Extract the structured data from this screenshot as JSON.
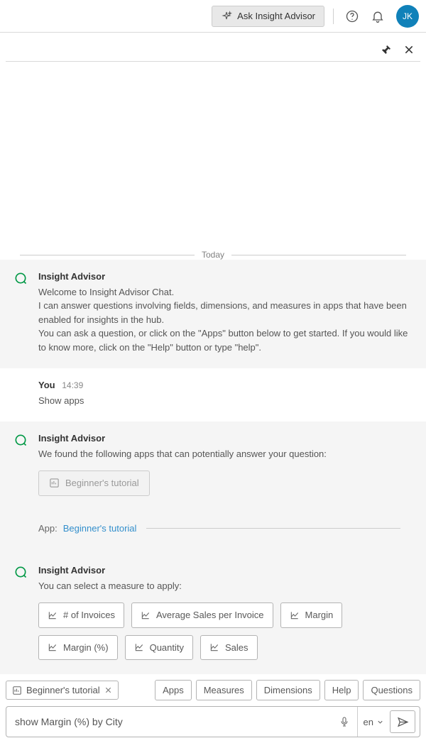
{
  "topbar": {
    "ask_label": "Ask Insight Advisor",
    "avatar_initials": "JK"
  },
  "chat": {
    "date_label": "Today",
    "messages": [
      {
        "sender": "Insight Advisor",
        "lines": [
          "Welcome to Insight Advisor Chat.",
          "I can answer questions involving fields, dimensions, and measures in apps that have been enabled for insights in the hub.",
          "You can ask a question, or click on the \"Apps\" button below to get started. If you would like to know more, click on the \"Help\" button or type \"help\"."
        ]
      },
      {
        "sender": "You",
        "timestamp": "14:39",
        "lines": [
          "Show apps"
        ]
      },
      {
        "sender": "Insight Advisor",
        "lines": [
          "We found the following apps that can potentially answer your question:"
        ],
        "app_chip": "Beginner's tutorial"
      }
    ],
    "app_context": {
      "label": "App:",
      "name": "Beginner's tutorial"
    },
    "measure_prompt": {
      "sender": "Insight Advisor",
      "text": "You can select a measure to apply:",
      "measures": [
        "# of Invoices",
        "Average Sales per Invoice",
        "Margin",
        "Margin (%)",
        "Quantity",
        "Sales"
      ]
    }
  },
  "bottom": {
    "context_chip": "Beginner's tutorial",
    "actions": [
      "Apps",
      "Measures",
      "Dimensions",
      "Help",
      "Questions"
    ],
    "input_value": "show Margin (%) by City",
    "lang": "en"
  }
}
